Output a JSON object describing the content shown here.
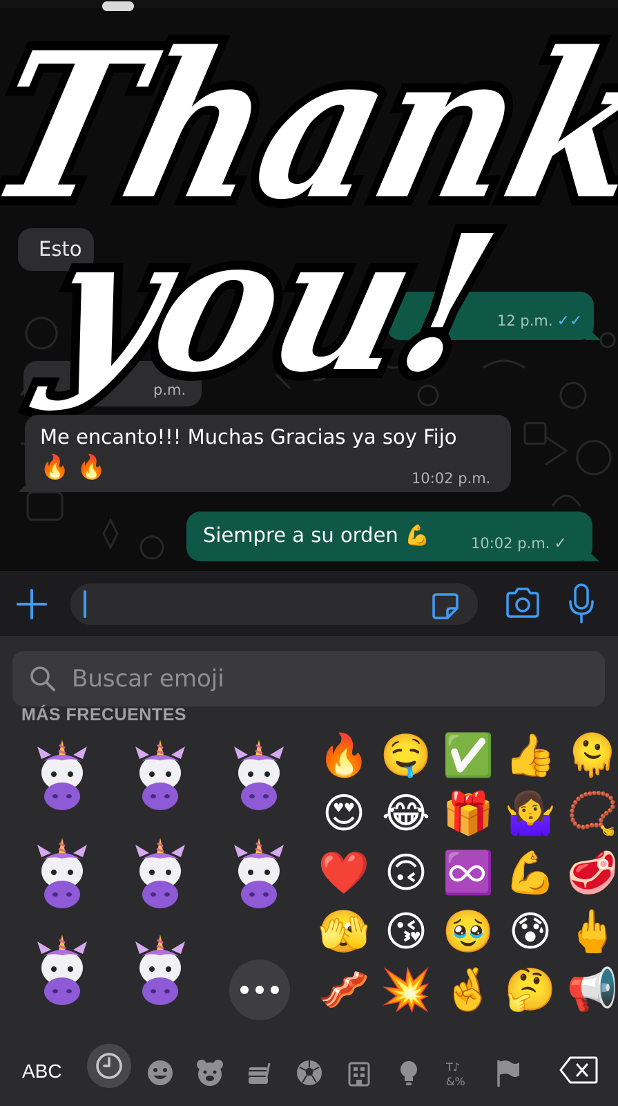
{
  "chat": {
    "sticker_text_line1": "Thank",
    "sticker_text_line2": "you!",
    "partial_in_text": "Esto",
    "partial_out_time": "12 p.m.",
    "partial_in_time": "p.m.",
    "messages": [
      {
        "direction": "incoming",
        "text_line1": "Me encanto!!! Muchas Gracias ya soy Fijo",
        "text_line2": "🔥 🔥",
        "time": "10:02 p.m."
      },
      {
        "direction": "outgoing",
        "text": "Siempre a su orden 💪",
        "time": "10:02 p.m.",
        "status": "sent"
      }
    ],
    "read_ticks": "✓✓",
    "sent_tick": "✓"
  },
  "input": {
    "placeholder": "",
    "icons": [
      "plus-icon",
      "sticker-icon",
      "camera-icon",
      "microphone-icon"
    ]
  },
  "keyboard": {
    "search_placeholder": "Buscar emoji",
    "section_title": "MÁS FRECUENTES",
    "memoji_names": [
      "unicorn-sleeping",
      "unicorn-crying-laughing",
      "unicorn-cursing",
      "unicorn-starstruck",
      "unicorn-heart-eyes",
      "unicorn-tongue",
      "unicorn-mind-blown",
      "unicorn-kiss"
    ],
    "emoji_rows": [
      [
        "🔥",
        "🤤",
        "✅",
        "👍",
        "🫠"
      ],
      [
        "😍",
        "😂",
        "🎁",
        "🤷‍♀️",
        "📿"
      ],
      [
        "❤️",
        "🙃",
        "♾️",
        "💪",
        "🥩"
      ],
      [
        "🫣",
        "😘",
        "🥹",
        "😰",
        "🖕"
      ],
      [
        "🥓",
        "💥",
        "🤞",
        "🤔",
        "📢"
      ]
    ],
    "abc_label": "ABC",
    "categories": [
      "recent-icon",
      "smileys-icon",
      "animals-icon",
      "food-icon",
      "activity-icon",
      "travel-icon",
      "objects-icon",
      "symbols-icon",
      "flags-icon"
    ],
    "selected_category": "recent-icon",
    "colors": {
      "accent": "#3e9cf6",
      "outgoing_bubble": "#0f5747",
      "incoming_bubble": "#2d2d2f",
      "keyboard_bg": "#2b2b2d"
    }
  }
}
